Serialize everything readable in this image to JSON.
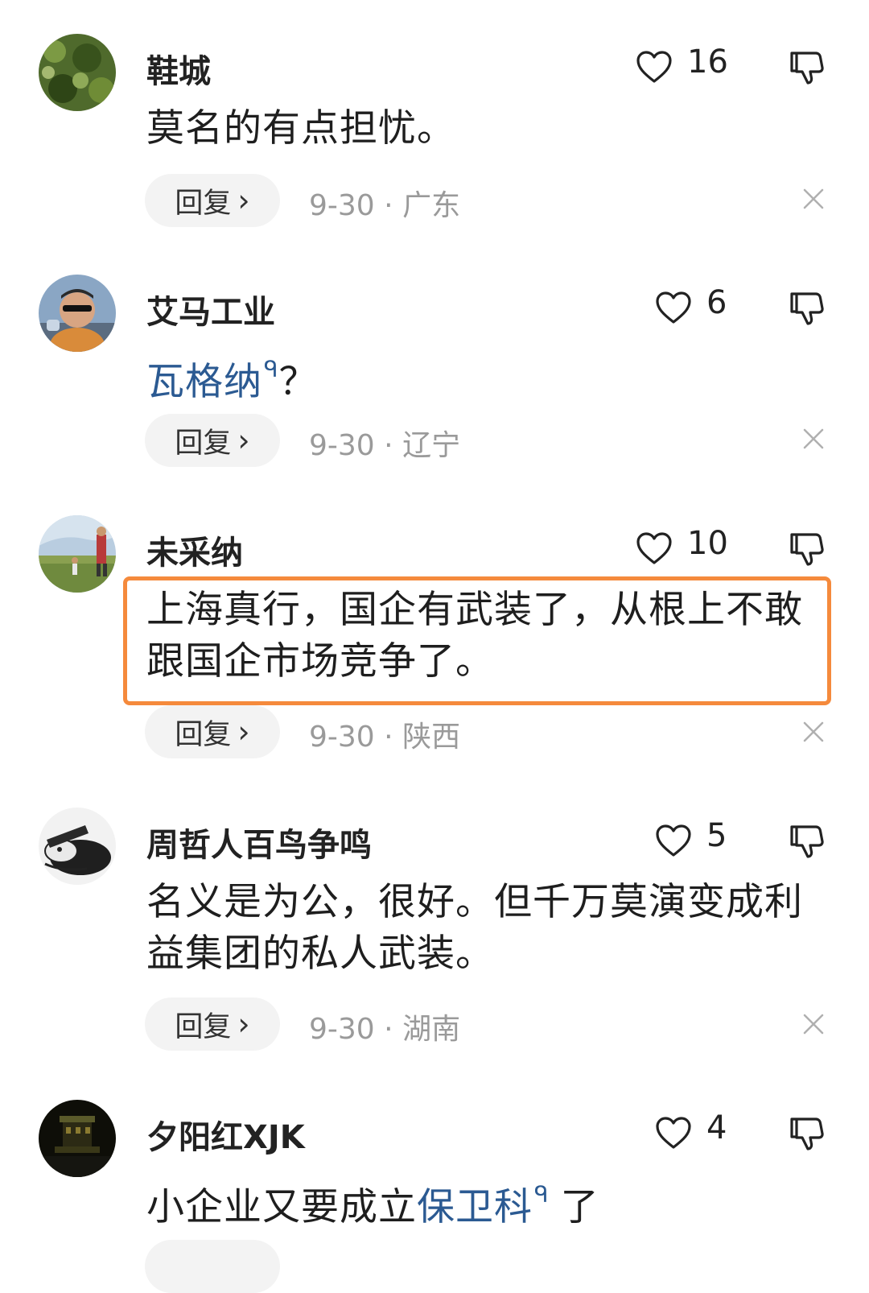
{
  "comments": [
    {
      "username": "鞋城",
      "likes": "16",
      "content": "莫名的有点担忧。",
      "reply_label": "回复",
      "date": "9-30",
      "location": "广东"
    },
    {
      "username": "艾马工业",
      "likes": "6",
      "content_link": "瓦格纳",
      "link_mark": "ᑫ",
      "content_after": "？",
      "reply_label": "回复",
      "date": "9-30",
      "location": "辽宁"
    },
    {
      "username": "未采纳",
      "likes": "10",
      "content_line1": "上海真行，国企有武装了，从根上不敢",
      "content_line2": "跟国企市场竞争了。",
      "reply_label": "回复",
      "date": "9-30",
      "location": "陕西"
    },
    {
      "username": "周哲人百鸟争鸣",
      "likes": "5",
      "content_line1": "名义是为公，很好。但千万莫演变成利",
      "content_line2": "益集团的私人武装。",
      "reply_label": "回复",
      "date": "9-30",
      "location": "湖南"
    },
    {
      "username": "夕阳红XJK",
      "likes": "4",
      "content_before": "小企业又要成立",
      "content_link": "保卫科",
      "link_mark": "ᑫ",
      "content_after": "了"
    }
  ],
  "separator": "·",
  "colors": {
    "highlight": "#f58a3c",
    "link": "#2b5a92",
    "meta": "#9a9a9a"
  }
}
